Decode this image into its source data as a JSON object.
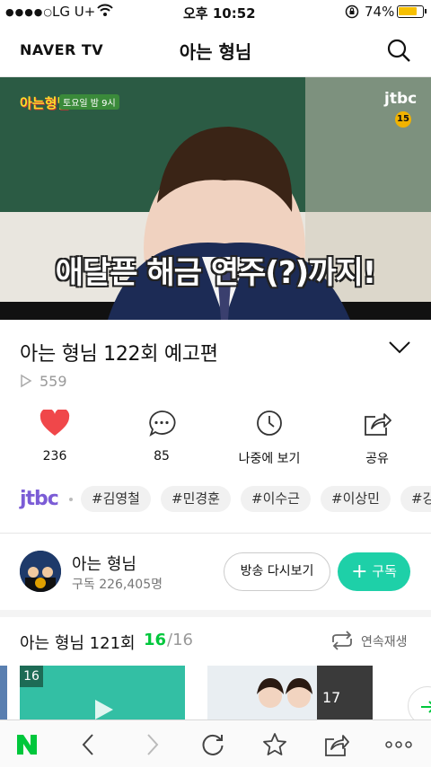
{
  "status_bar": {
    "carrier": "LG U+",
    "time": "오후 10:52",
    "battery": "74%"
  },
  "header": {
    "logo": "NAVER TV",
    "title": "아는 형님"
  },
  "player": {
    "show_logo": "아는형님",
    "schedule": "토요일 밤 9시",
    "channel_mark": "jtbc",
    "rating": "15",
    "caption": "애달픈 해금 연주(?)까지!"
  },
  "video": {
    "title": "아는 형님 122회 예고편",
    "play_count": "559"
  },
  "actions": {
    "like_count": "236",
    "comment_count": "85",
    "watch_later_label": "나중에 보기",
    "share_label": "공유"
  },
  "tags": {
    "broadcaster": "jtbc",
    "items": [
      "#김영철",
      "#민경훈",
      "#이수근",
      "#이상민",
      "#강호동"
    ]
  },
  "channel": {
    "name": "아는 형님",
    "subscribers": "구독 226,405명",
    "replay_label": "방송 다시보기",
    "subscribe_label": "구독"
  },
  "playlist": {
    "title": "아는 형님 121회",
    "current": "16",
    "total": "/16",
    "autoplay_label": "연속재생",
    "thumb1_badge": "16",
    "thumb2_badge": "17"
  },
  "colors": {
    "accent": "#00c73c",
    "like": "#f0474a",
    "subscribe_bg": "#1ed0a8"
  }
}
